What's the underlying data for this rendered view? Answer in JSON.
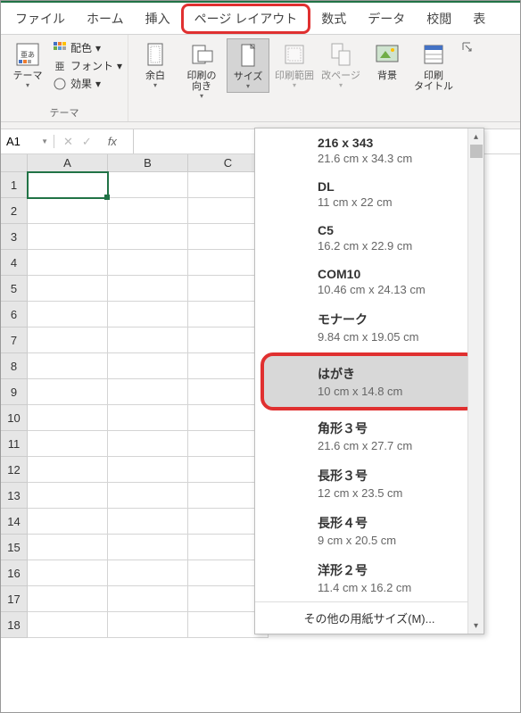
{
  "tabs": {
    "file": "ファイル",
    "home": "ホーム",
    "insert": "挿入",
    "page_layout": "ページ レイアウト",
    "formulas": "数式",
    "data": "データ",
    "review": "校閲",
    "view": "表"
  },
  "ribbon": {
    "themes": {
      "theme": "テーマ",
      "colors": "配色",
      "fonts": "フォント",
      "effects": "効果",
      "group": "テーマ"
    },
    "page_setup": {
      "margins": "余白",
      "orientation": "印刷の\n向き",
      "size": "サイズ",
      "print_area": "印刷範囲",
      "breaks": "改ページ",
      "background": "背景",
      "print_titles": "印刷\nタイトル"
    }
  },
  "formula_bar": {
    "name": "A1",
    "fx": "fx"
  },
  "columns": [
    "A",
    "B",
    "C"
  ],
  "rows": [
    "1",
    "2",
    "3",
    "4",
    "5",
    "6",
    "7",
    "8",
    "9",
    "10",
    "11",
    "12",
    "13",
    "14",
    "15",
    "16",
    "17",
    "18"
  ],
  "size_menu": {
    "items": [
      {
        "name": "216 x 343",
        "size": "21.6 cm x 34.3 cm"
      },
      {
        "name": "DL",
        "size": "11 cm x 22 cm"
      },
      {
        "name": "C5",
        "size": "16.2 cm x 22.9 cm"
      },
      {
        "name": "COM10",
        "size": "10.46 cm x 24.13 cm"
      },
      {
        "name": "モナーク",
        "size": "9.84 cm x 19.05 cm"
      },
      {
        "name": "はがき",
        "size": "10 cm x 14.8 cm"
      },
      {
        "name": "角形３号",
        "size": "21.6 cm x 27.7 cm"
      },
      {
        "name": "長形３号",
        "size": "12 cm x 23.5 cm"
      },
      {
        "name": "長形４号",
        "size": "9 cm x 20.5 cm"
      },
      {
        "name": "洋形２号",
        "size": "11.4 cm x 16.2 cm"
      }
    ],
    "more": "その他の用紙サイズ(M)..."
  }
}
